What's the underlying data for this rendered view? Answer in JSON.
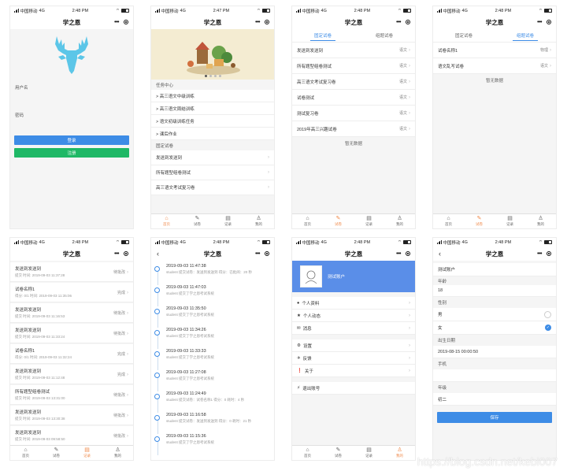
{
  "app_title": "学之恩",
  "status": {
    "carrier": "中国移动",
    "net": "4G"
  },
  "tabs": [
    "首页",
    "试卷",
    "记录",
    "我的"
  ],
  "colors": {
    "primary": "#3d8ce6",
    "success": "#1fb866",
    "accent": "#f08a4b",
    "profile_bg": "#5a8ee8"
  },
  "screen1": {
    "time": "2:48 PM",
    "username_label": "用户名",
    "password_label": "密码",
    "login_button": "登录",
    "register_button": "注册"
  },
  "screen2": {
    "time": "2:47 PM",
    "section_tasks": "任务中心",
    "tasks": [
      "> 高三语文中级训练",
      "> 高三语文周结训练",
      "> 语文初级训练任务",
      "> 课后作业"
    ],
    "section_fixed": "固定试卷",
    "fixed": [
      "发送到发送到",
      "所有题型组卷测试",
      "高三语文考试复习卷"
    ]
  },
  "screen3": {
    "time": "2:48 PM",
    "tab_fixed": "固定试卷",
    "tab_random": "组题试卷",
    "rows": [
      {
        "name": "发送到发送到",
        "subject": "语文"
      },
      {
        "name": "所有题型组卷测试",
        "subject": "语文"
      },
      {
        "name": "高三语文考试复习卷",
        "subject": "语文"
      },
      {
        "name": "试卷测试",
        "subject": "语文"
      },
      {
        "name": "测试复习卷",
        "subject": "语文"
      },
      {
        "name": "2019年高三兴趣试卷",
        "subject": "语文"
      }
    ],
    "empty_text": "暂无数据"
  },
  "screen4": {
    "time": "2:48 PM",
    "tab_fixed": "固定试卷",
    "tab_random": "组题试卷",
    "rows": [
      {
        "name": "试卷名称1",
        "subject": "物理"
      },
      {
        "name": "语文乱写试卷",
        "subject": "语文"
      }
    ],
    "empty_text": "暂无数据"
  },
  "screen5": {
    "time": "2:48 PM",
    "records": [
      {
        "title": "发送到发送到",
        "meta": "提交 时间: 2019-09-03 11:37:28",
        "status": "待批改"
      },
      {
        "title": "试卷名称1",
        "meta": "得分: 0/1 时间: 2019-09-03 11:35:06",
        "status": "完成"
      },
      {
        "title": "发送到发送到",
        "meta": "提交 时间: 2019-09-03 11:16:53",
        "status": "待批改"
      },
      {
        "title": "发送到发送到",
        "meta": "提交 时间: 2019-09-03 11:33:24",
        "status": "待批改"
      },
      {
        "title": "试卷名称1",
        "meta": "得分: 0/1 时间: 2019-09-03 11:32:24",
        "status": "完成"
      },
      {
        "title": "发送到发送到",
        "meta": "提交 时间: 2019-09-03 11:12:48",
        "status": "完成"
      },
      {
        "title": "所有题型组卷测试",
        "meta": "提交 时间: 2019-09-03 13:31:00",
        "status": "待批改"
      },
      {
        "title": "发送到发送到",
        "meta": "提交 时间: 2019-09-03 13:30:38",
        "status": "待批改"
      },
      {
        "title": "发送到发送到",
        "meta": "提交 时间: 2019-09-03 09:58:50",
        "status": "待批改"
      }
    ]
  },
  "screen6": {
    "time": "2:48 PM",
    "items": [
      {
        "time": "2019-09-03 11:47:38",
        "text": "student 提交试卷：发送到发送到 得分：已批阅：20 秒"
      },
      {
        "time": "2019-09-03 11:47:03",
        "text": "student 提交了学之恩考试系统"
      },
      {
        "time": "2019-09-03 11:35:50",
        "text": "student 提交了学之恩考试系统"
      },
      {
        "time": "2019-09-03 11:34:26",
        "text": "student 提交了学之恩考试系统"
      },
      {
        "time": "2019-09-03 11:33:33",
        "text": "student 提交了学之恩考试系统"
      },
      {
        "time": "2019-09-03 11:27:08",
        "text": "student 提交了学之恩考试系统"
      },
      {
        "time": "2019-09-03 11:24:49",
        "text": "student 提交试卷：试卷名称1 得分：0 耗时：4 秒"
      },
      {
        "time": "2019-09-03 11:16:58",
        "text": "student 提交试卷：发送到发送到 得分：0 耗时：21 秒"
      },
      {
        "time": "2019-09-03 11:15:36",
        "text": "student 提交了学之恩考试系统"
      }
    ]
  },
  "screen7": {
    "time": "2:48 PM",
    "user_name": "测试账户",
    "group1": [
      "个人资料",
      "个人动态",
      "消息"
    ],
    "group2": [
      "设置",
      "反馈",
      "关于"
    ],
    "logout": "退出账号"
  },
  "screen8": {
    "time": "2:48 PM",
    "name_value": "测试账户",
    "age_label": "年龄",
    "age_value": "18",
    "gender_label": "性别",
    "gender_male": "男",
    "gender_female": "女",
    "birthday_label": "出生日期",
    "birthday_value": "2019-08-15 00:00:50",
    "phone_label": "手机",
    "grade_label": "年级",
    "grade_value": "初二",
    "save_button": "保存"
  },
  "watermark": "https://blog.csdn.net/kebi007"
}
